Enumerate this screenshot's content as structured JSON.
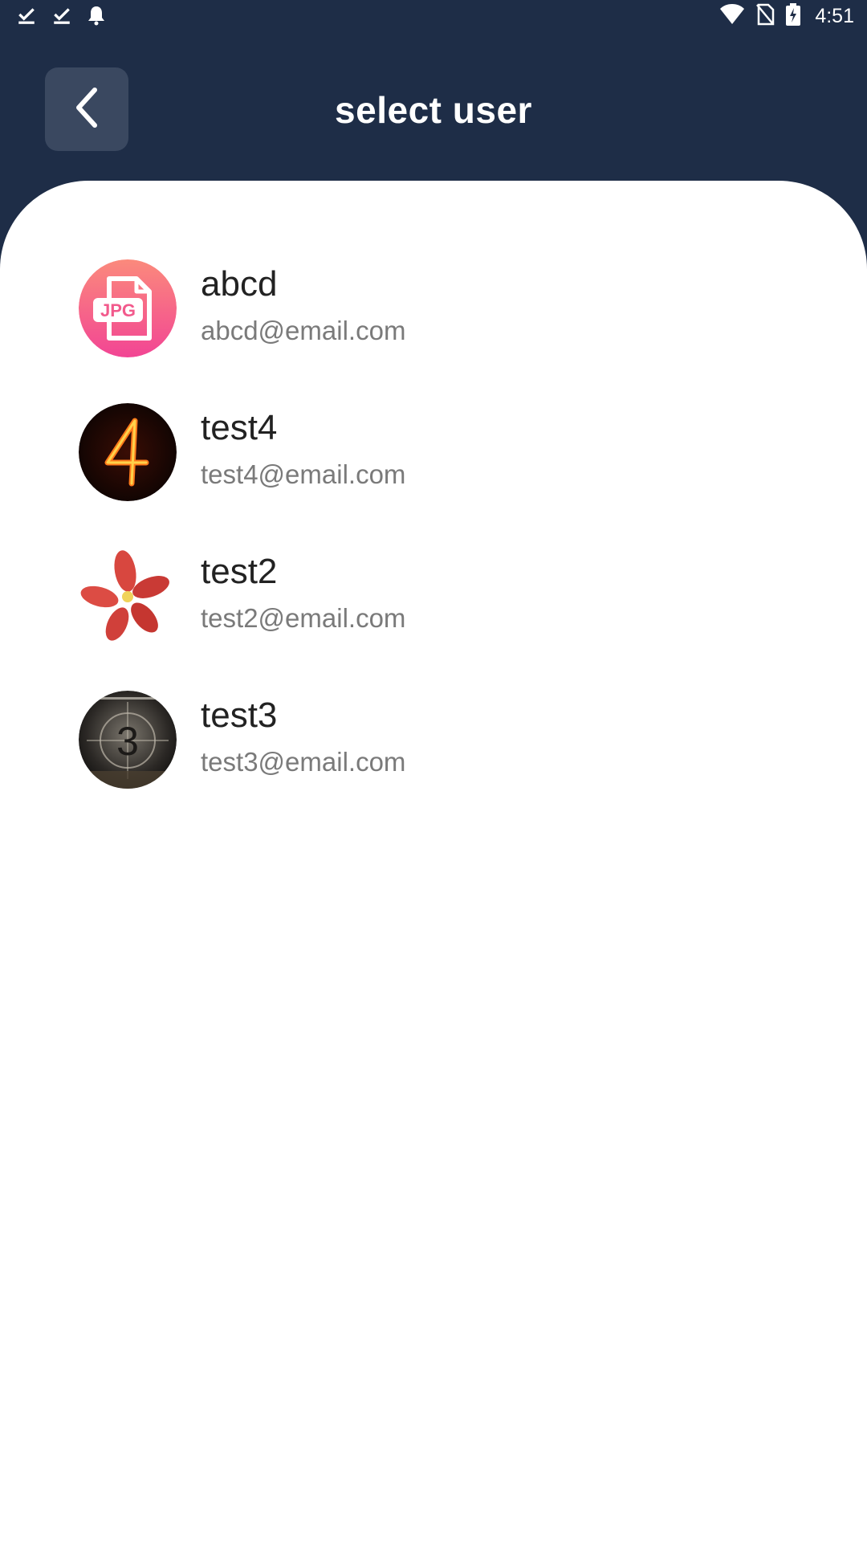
{
  "status_bar": {
    "time": "4:51",
    "icons_left": [
      "download-done-icon",
      "download-done-icon",
      "notification-bell-icon"
    ],
    "icons_right": [
      "wifi-icon",
      "no-sim-icon",
      "battery-charging-icon"
    ]
  },
  "header": {
    "title": "select user",
    "back_icon": "chevron-left-icon",
    "background_color": "#1e2d47"
  },
  "users": [
    {
      "name": "abcd",
      "email": "abcd@email.com",
      "avatar": "jpg-file-icon"
    },
    {
      "name": "test4",
      "email": "test4@email.com",
      "avatar": "number-4-fire-photo"
    },
    {
      "name": "test2",
      "email": "test2@email.com",
      "avatar": "red-flower-photo"
    },
    {
      "name": "test3",
      "email": "test3@email.com",
      "avatar": "number-3-countdown-photo"
    }
  ]
}
